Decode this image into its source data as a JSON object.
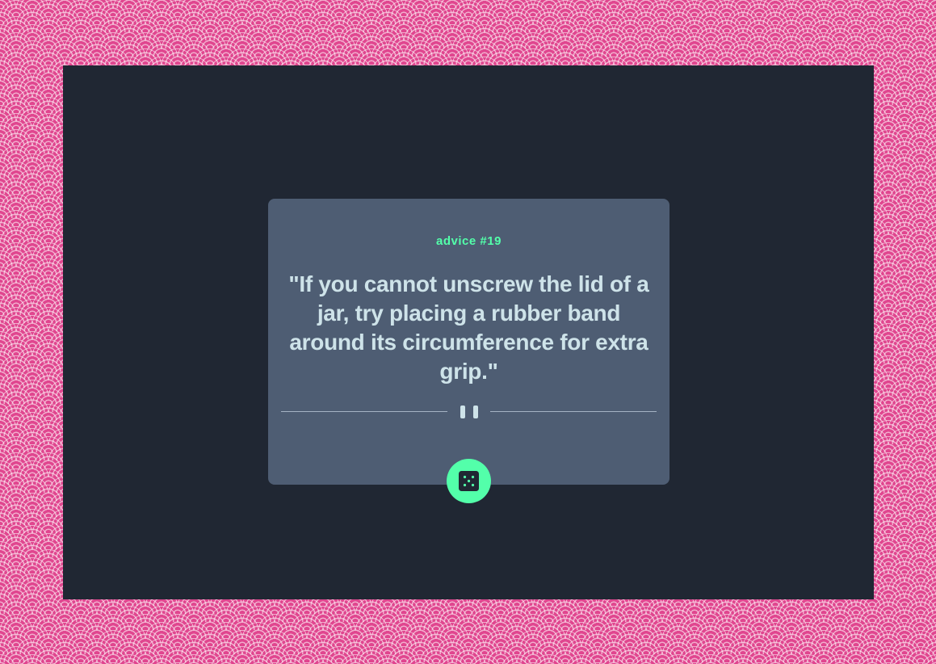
{
  "advice": {
    "id_label": "advice #19",
    "text": "\"If you cannot unscrew the lid of a jar, try placing a rubber band around its circumference for extra grip.\""
  },
  "icons": {
    "divider": "pause-icon",
    "button": "dice-icon"
  },
  "colors": {
    "background_pattern": "#e0468f",
    "page_background": "#202733",
    "card": "#4e5d73",
    "accent": "#53ffaa",
    "text": "#cee3e9",
    "divider_line": "#a5b3c4"
  }
}
